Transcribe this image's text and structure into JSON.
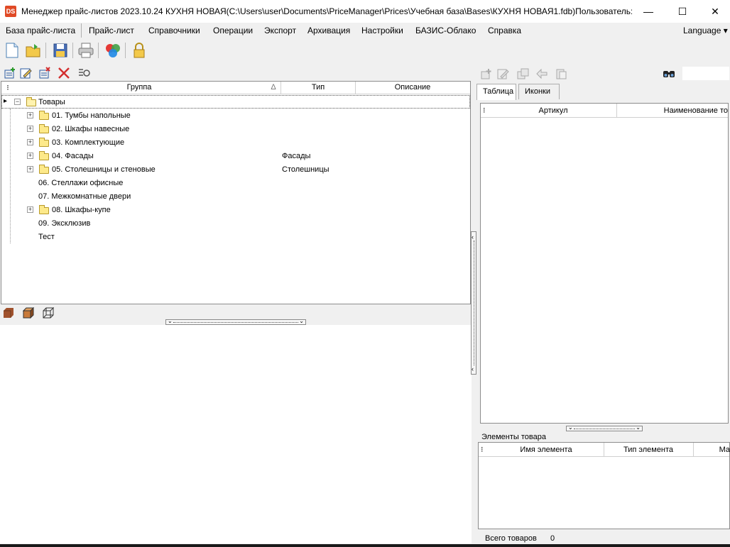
{
  "window": {
    "title": "Менеджер прайс-листов 2023.10.24  КУХНЯ НОВАЯ(C:\\Users\\user\\Documents\\PriceManager\\Prices\\Учебная база\\Bases\\КУХНЯ НОВАЯ1.fdb)Пользователь: ...",
    "app_icon": "DS",
    "minimize": "—",
    "maximize": "☐",
    "close": "✕"
  },
  "menu": {
    "items": [
      "База прайс-листа",
      "Прайс-лист",
      "Справочники",
      "Операции",
      "Экспорт",
      "Архивация",
      "Настройки",
      "БАЗИС-Облако",
      "Справка"
    ],
    "language": "Language ▾"
  },
  "grid": {
    "columns": {
      "group": "Группа",
      "sort_indicator": "Δ",
      "type": "Тип",
      "description": "Описание"
    },
    "root": "Товары",
    "rows": [
      {
        "label": "01. Тумбы напольные",
        "type": "",
        "has_children": true
      },
      {
        "label": "02. Шкафы навесные",
        "type": "",
        "has_children": true
      },
      {
        "label": "03. Комплектующие",
        "type": "",
        "has_children": true
      },
      {
        "label": "04. Фасады",
        "type": "Фасады",
        "has_children": true
      },
      {
        "label": "05. Столешницы и стеновые",
        "type": "Столешницы",
        "has_children": true
      },
      {
        "label": "06. Стеллажи офисные",
        "type": "",
        "has_children": false
      },
      {
        "label": "07. Межкомнатные двери",
        "type": "",
        "has_children": false
      },
      {
        "label": "08. Шкафы-купе",
        "type": "",
        "has_children": true
      },
      {
        "label": "09. Эксклюзив",
        "type": "",
        "has_children": false
      },
      {
        "label": "Тест",
        "type": "",
        "has_children": false
      }
    ]
  },
  "right": {
    "tabs": [
      "Таблица",
      "Иконки"
    ],
    "table_columns": {
      "article": "Артикул",
      "name": "Наименование то"
    },
    "elements_label": "Элементы товара",
    "elements_columns": {
      "name": "Имя элемента",
      "type": "Тип элемента",
      "more": "Ма"
    },
    "status_label": "Всего товаров",
    "status_value": "0"
  },
  "icons": {
    "binoculars": "🔍"
  }
}
